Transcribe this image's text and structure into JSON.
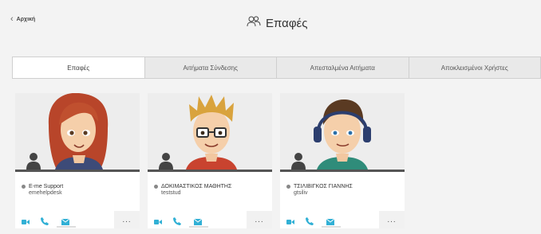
{
  "header": {
    "back_label": "Αρχική",
    "title": "Επαφές",
    "title_icon": "contacts-icon",
    "back_icon": "chevron-left-icon"
  },
  "tabs": [
    {
      "label": "Επαφές",
      "active": true
    },
    {
      "label": "Αιτήματα Σύνδεσης",
      "active": false
    },
    {
      "label": "Απεσταλμένα Αιτήματα",
      "active": false
    },
    {
      "label": "Αποκλεισμένοι Χρήστες",
      "active": false
    }
  ],
  "contacts": [
    {
      "name": "E-me Support",
      "username": "emehelpdesk",
      "status": "offline"
    },
    {
      "name": "ΔΟΚΙΜΑΣΤΙΚΟΣ ΜΑΘΗΤΗΣ",
      "username": "teststud",
      "status": "offline"
    },
    {
      "name": "ΤΣΙΛΙΒΙΓΚΟΣ ΓΙΑΝΝΗΣ",
      "username": "gtsiliv",
      "status": "offline"
    }
  ],
  "card_actions": {
    "video_icon": "video-camera-icon",
    "phone_icon": "phone-icon",
    "mail_icon": "mail-icon",
    "more_label": "...",
    "accent": "#31b0d5"
  },
  "colors": {
    "background": "#f3f3f3",
    "status_offline": "#888888"
  }
}
